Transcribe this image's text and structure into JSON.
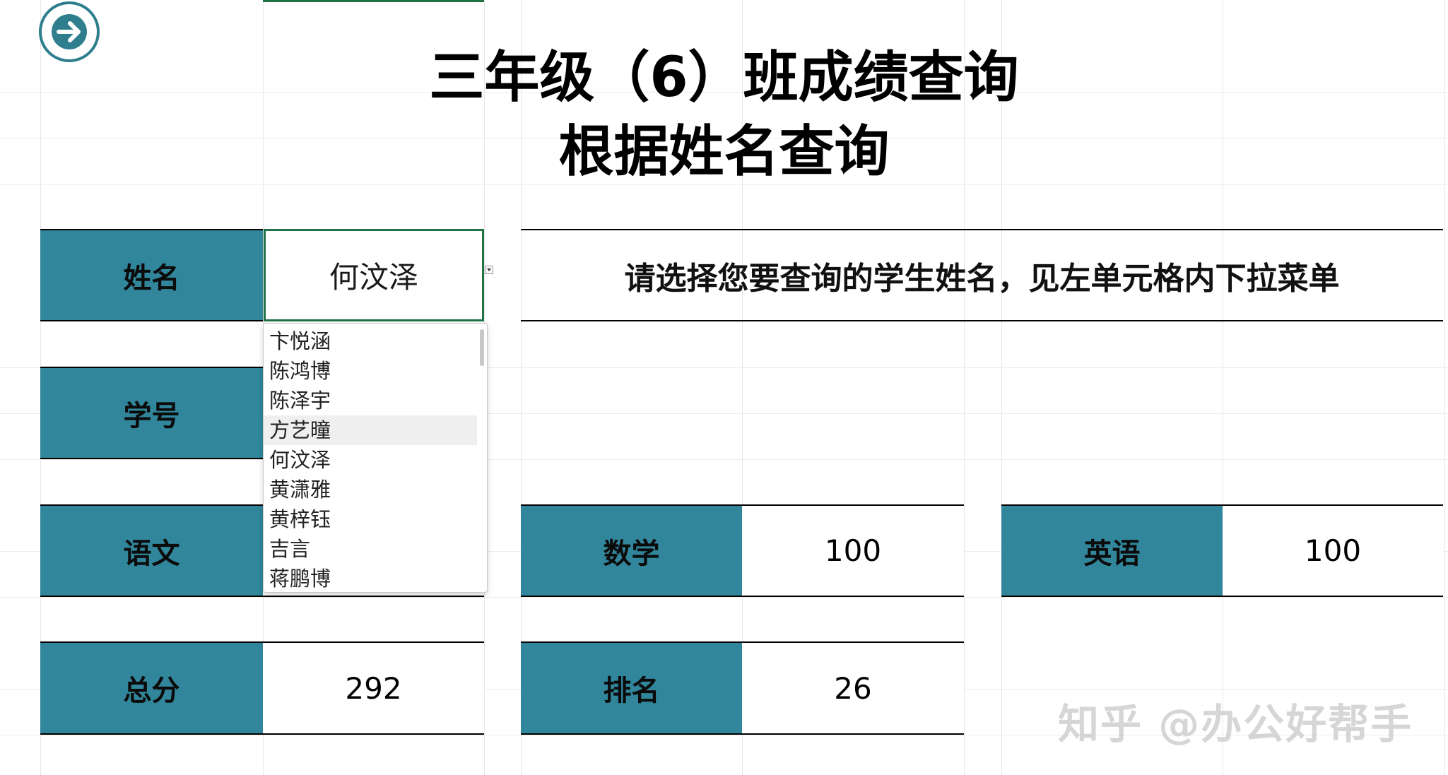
{
  "title": {
    "line1": "三年级（6）班成绩查询",
    "line2": "根据姓名查询"
  },
  "name_field": {
    "label": "姓名",
    "value": "何汶泽"
  },
  "instruction": "请选择您要查询的学生姓名，见左单元格内下拉菜单",
  "dropdown": {
    "options": [
      "卞悦涵",
      "陈鸿博",
      "陈泽宇",
      "方艺曈",
      "何汶泽",
      "黄潇雅",
      "黄梓钰",
      "吉言",
      "蒋鹏博"
    ],
    "highlighted": "方艺曈"
  },
  "fields": {
    "student_id": {
      "label": "学号",
      "value": ""
    },
    "chinese": {
      "label": "语文",
      "value": ""
    },
    "math": {
      "label": "数学",
      "value": "100"
    },
    "english": {
      "label": "英语",
      "value": "100"
    },
    "total": {
      "label": "总分",
      "value": "292"
    },
    "rank": {
      "label": "排名",
      "value": "26"
    }
  },
  "watermark": "知乎 @办公好帮手",
  "colors": {
    "label_fill": "#31869b",
    "accent": "#2e7e8e",
    "selection_border": "#217346"
  },
  "icons": {
    "nav": "arrow-right-circle-icon",
    "dropdown": "dropdown-arrow-icon"
  }
}
